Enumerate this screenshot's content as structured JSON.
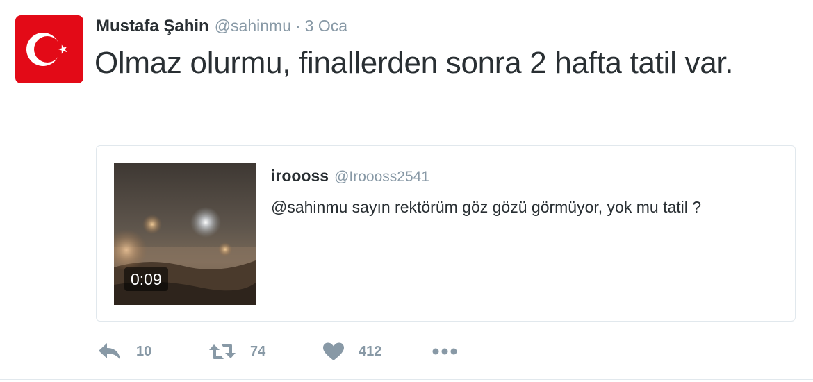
{
  "author": {
    "display_name": "Mustafa Şahin",
    "handle": "@sahinmu",
    "separator": "·",
    "timestamp": "3 Oca",
    "avatar_icon": "turkish-flag-icon"
  },
  "tweet": {
    "text": "Olmaz olurmu, finallerden sonra 2 hafta tatil var."
  },
  "quoted_tweet": {
    "display_name": "iroooss",
    "handle": "@Iroooss2541",
    "text": "@sahinmu sayın rektörüm göz gözü görmüyor, yok mu tatil ?",
    "media": {
      "type": "video",
      "duration": "0:09"
    }
  },
  "actions": {
    "reply": {
      "icon": "reply-icon",
      "count": "10"
    },
    "retweet": {
      "icon": "retweet-icon",
      "count": "74"
    },
    "like": {
      "icon": "heart-icon",
      "count": "412"
    },
    "more": {
      "icon": "more-dots-icon"
    }
  },
  "colors": {
    "text_primary": "#292f33",
    "text_secondary": "#8899a6",
    "border": "#e1e8ed",
    "flag_red": "#e30a17"
  }
}
